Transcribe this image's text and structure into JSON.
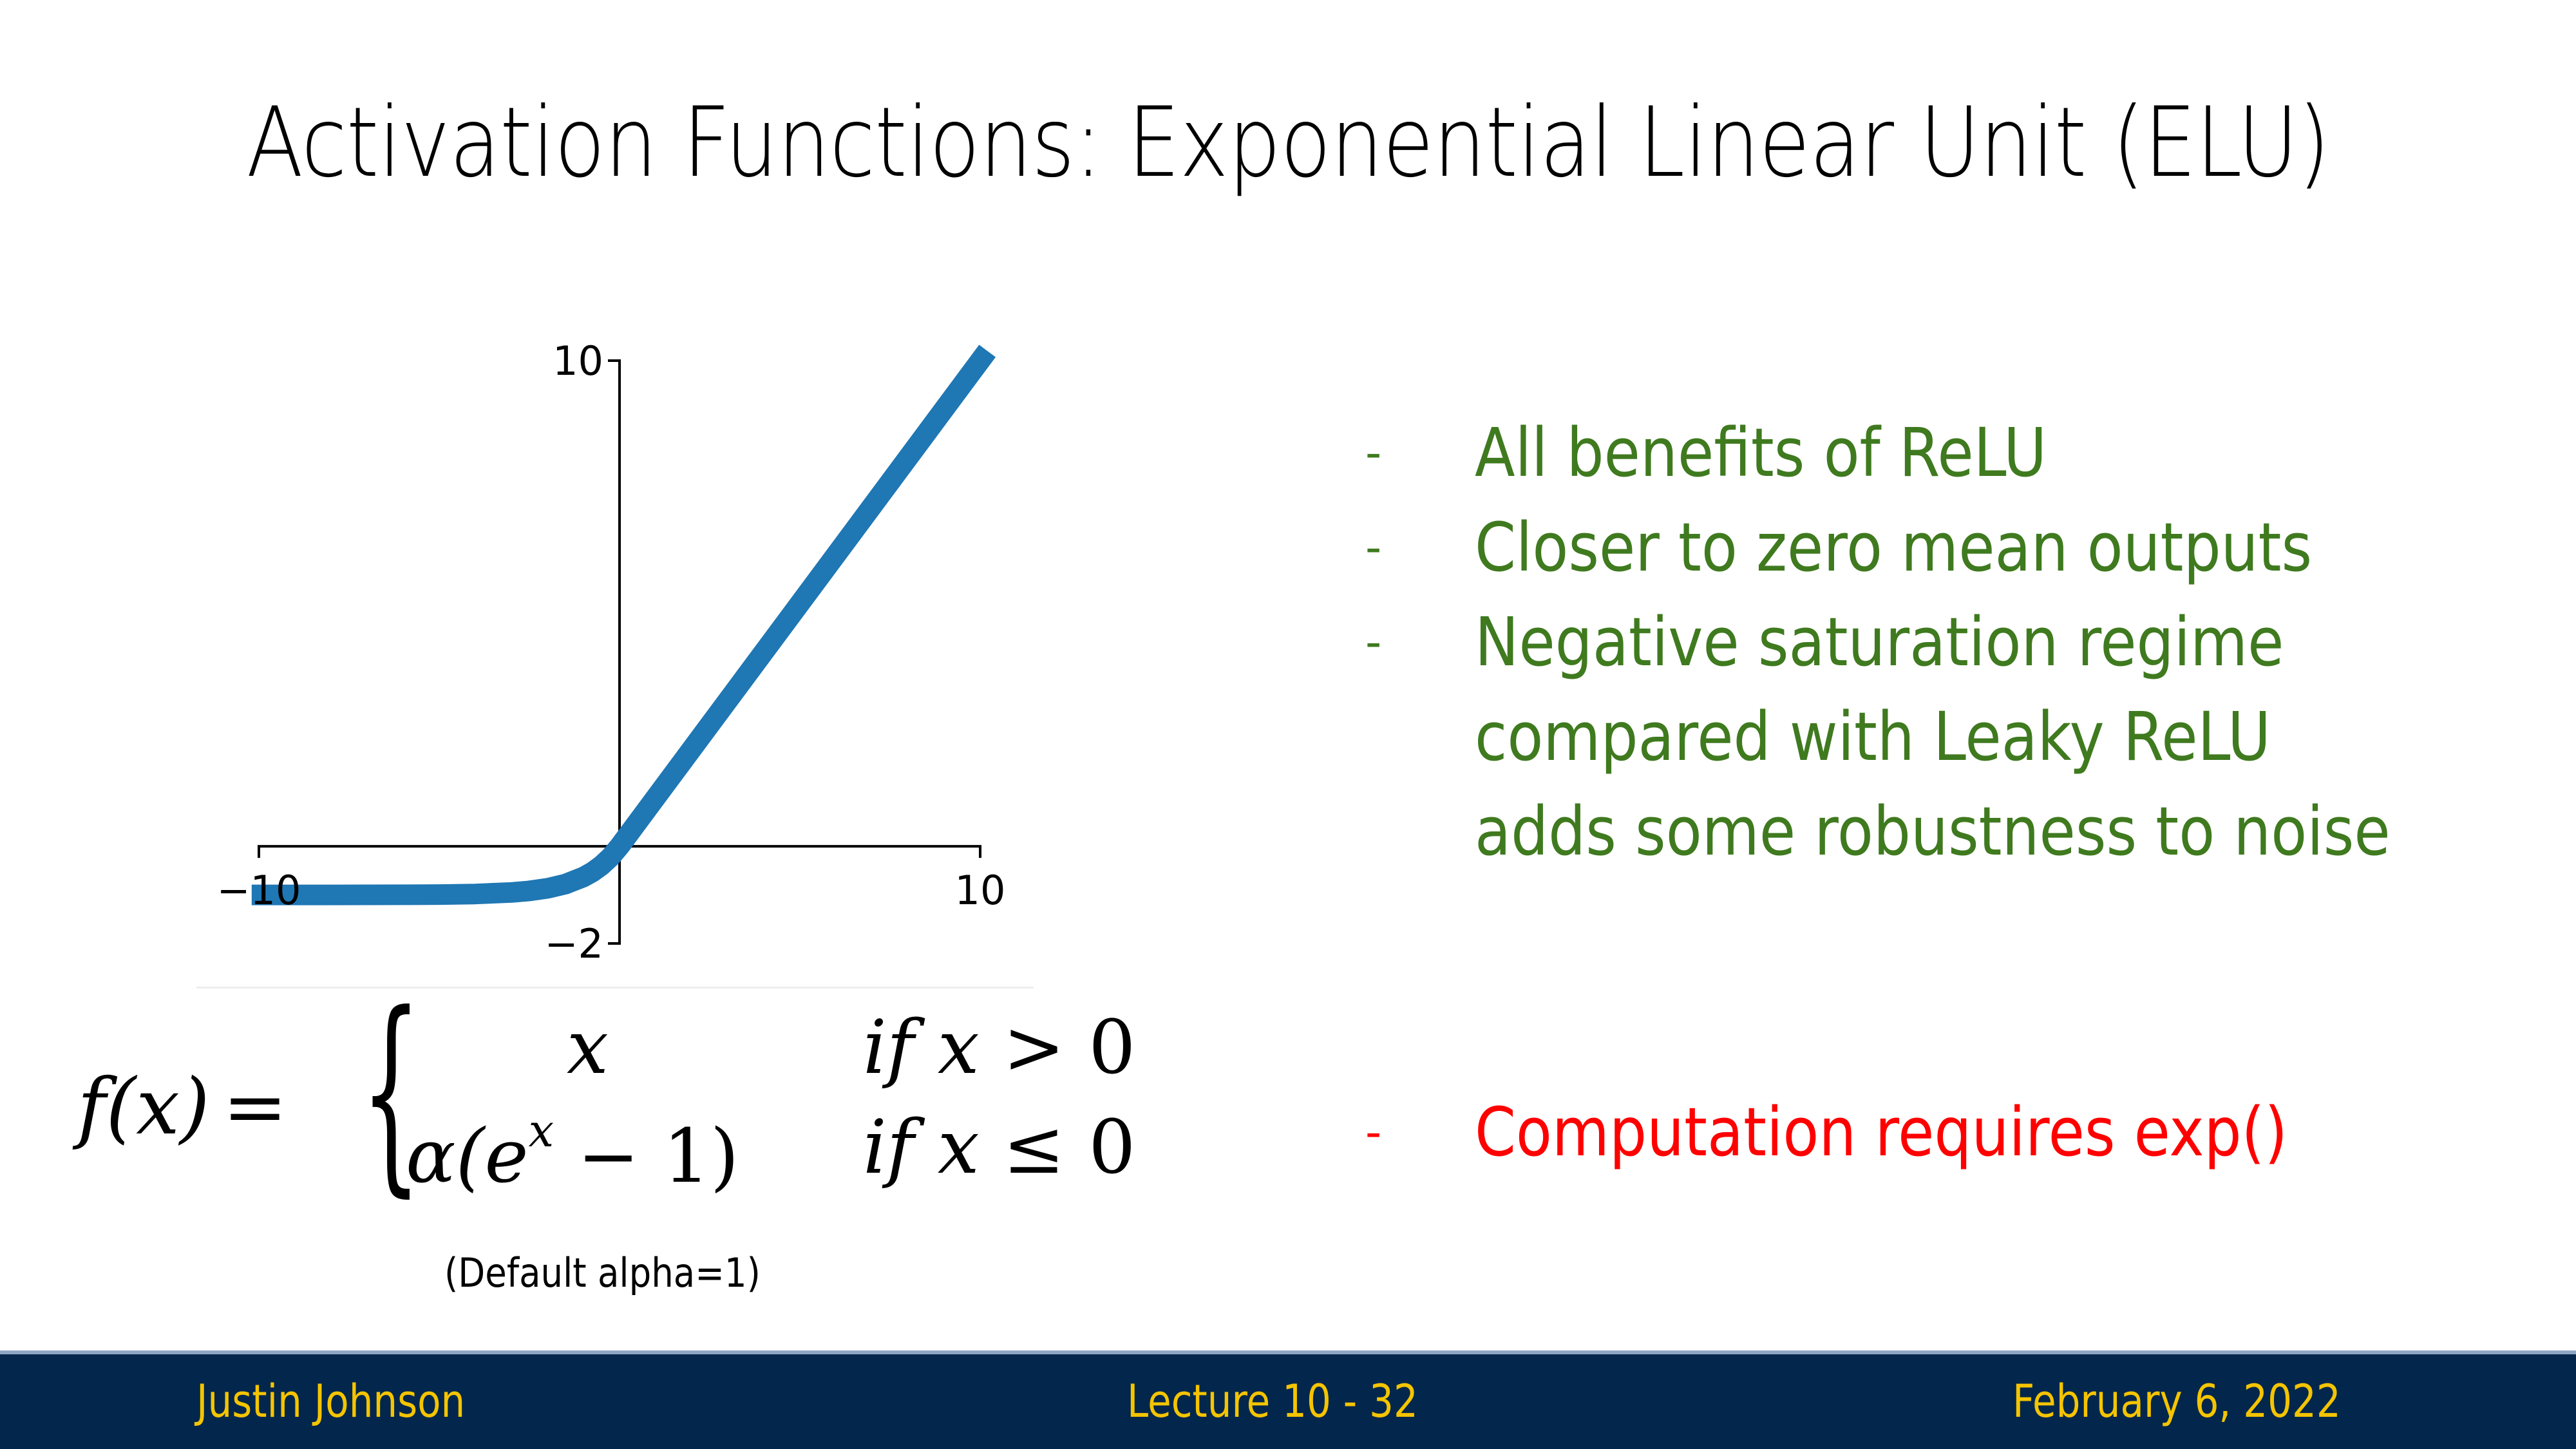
{
  "slide": {
    "title": "Activation Functions: Exponential Linear Unit (ELU)"
  },
  "chart_data": {
    "type": "line",
    "title": "",
    "xlabel": "",
    "ylabel": "",
    "function": "ELU, alpha=1",
    "xlim": [
      -10,
      10
    ],
    "ylim": [
      -2,
      10
    ],
    "xticks": [
      -10,
      10
    ],
    "yticks": [
      -2,
      10
    ],
    "xtick_labels": [
      "−10",
      "10"
    ],
    "ytick_labels": [
      "−2",
      "10"
    ],
    "grid": false,
    "legend": "none",
    "series": [
      {
        "name": "ELU",
        "color": "#1f77b4",
        "x": [
          -10.2,
          -8,
          -6,
          -5,
          -4,
          -3,
          -2.5,
          -2,
          -1.5,
          -1,
          -0.75,
          -0.5,
          -0.25,
          0,
          2,
          4,
          6,
          8,
          10.2
        ],
        "y": [
          -1.0,
          -1.0,
          -0.998,
          -0.993,
          -0.982,
          -0.95,
          -0.918,
          -0.865,
          -0.777,
          -0.632,
          -0.528,
          -0.393,
          -0.221,
          0,
          2,
          4,
          6,
          8,
          10.2
        ]
      }
    ]
  },
  "formula": {
    "lhs": "f(x)",
    "equals": "=",
    "case1_value": "x",
    "case1_condition_if": "if",
    "case1_condition_var": "x",
    "case1_condition_op": ">",
    "case1_condition_num": "0",
    "case2_alpha": "α(e",
    "case2_sup": "x",
    "case2_rest": " − 1)",
    "case2_condition_if": "if",
    "case2_condition_var": "x",
    "case2_condition_op": "≤",
    "case2_condition_num": "0",
    "note": "(Default alpha=1)"
  },
  "bullets": {
    "dash": "-",
    "green_color": "#3f7a1f",
    "red_color": "#ff0000",
    "pros": [
      {
        "lines": [
          "All benefits of ReLU"
        ]
      },
      {
        "lines": [
          "Closer to zero mean outputs"
        ]
      },
      {
        "lines": [
          "Negative saturation regime",
          "compared with Leaky ReLU",
          "adds some robustness to noise"
        ]
      }
    ],
    "con": "Computation requires exp()"
  },
  "footer": {
    "author": "Justin Johnson",
    "lecture": "Lecture 10 - 32",
    "date": "February 6, 2022",
    "background": "#03274c",
    "text_color": "#f5c400"
  }
}
